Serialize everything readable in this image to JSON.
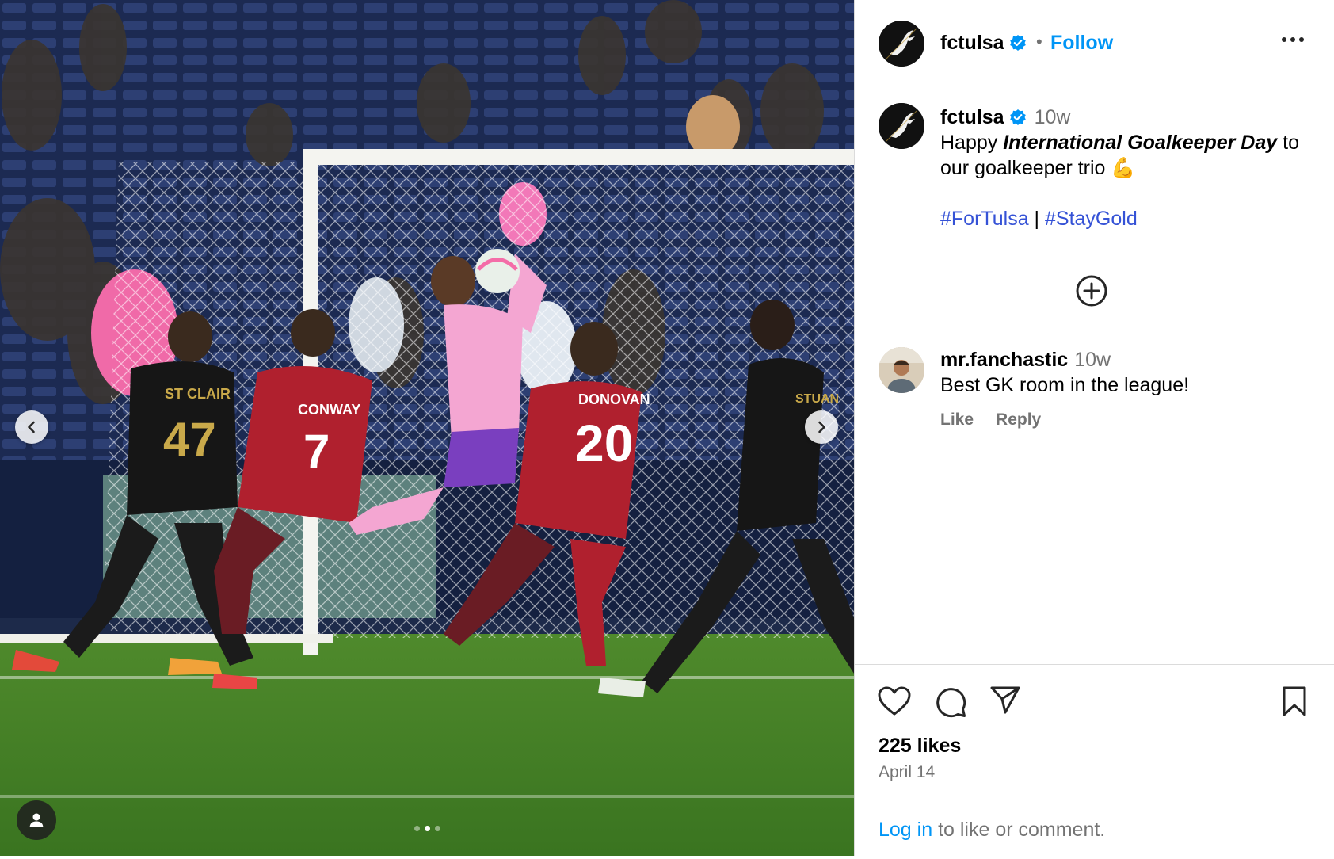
{
  "post": {
    "username": "fctulsa",
    "follow_label": "Follow",
    "separator": "•",
    "caption": {
      "time": "10w",
      "text_before": "Happy ",
      "text_emphasis": "International Goalkeeper Day",
      "text_after": " to our goalkeeper trio 💪",
      "hashtag_1": "#ForTulsa",
      "hashtag_sep": " | ",
      "hashtag_2": "#StayGold"
    },
    "comment": {
      "username": "mr.fanchastic",
      "time": "10w",
      "text": "Best GK room in the league!",
      "like_label": "Like",
      "reply_label": "Reply"
    },
    "likes": "225 likes",
    "date": "April 14",
    "login_link": "Log in",
    "login_rest": " to like or comment."
  },
  "media": {
    "carousel_index": 2,
    "carousel_total": 3,
    "jersey_names": [
      "ST CLAIR",
      "CONWAY",
      "DONOVAN",
      "STUAN"
    ],
    "jersey_numbers": [
      "47",
      "7",
      "20"
    ]
  },
  "colors": {
    "accent": "#0095f6",
    "hashtag": "#3552d6",
    "verified": "#0095f6",
    "muted": "#737373",
    "divider": "#dbdbdb"
  },
  "icons": {
    "more": "more-horizontal-icon",
    "verified": "verified-badge-icon",
    "add_comment": "plus-circle-icon",
    "like": "heart-icon",
    "comment": "comment-bubble-icon",
    "share": "paper-plane-icon",
    "save": "bookmark-icon",
    "prev": "chevron-left-icon",
    "next": "chevron-right-icon",
    "tags": "user-tag-icon"
  }
}
